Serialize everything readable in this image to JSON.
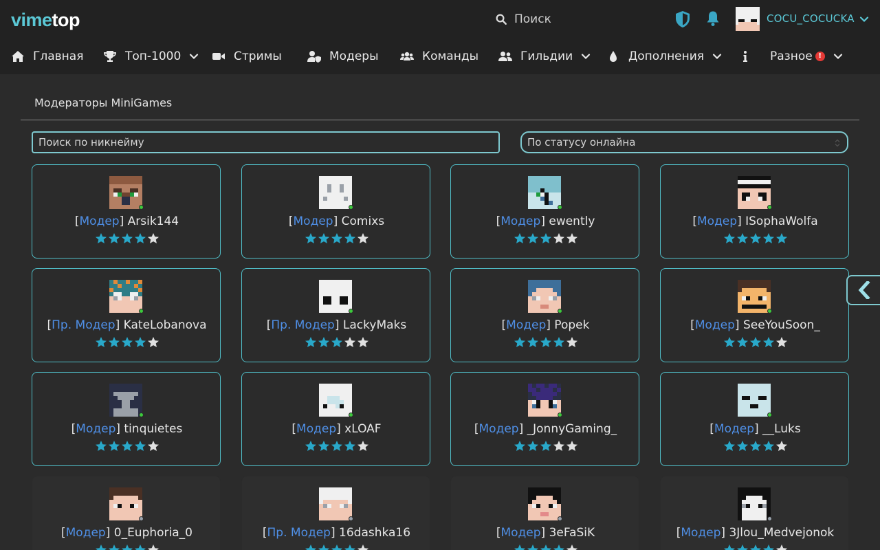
{
  "header": {
    "logo_part1": "vime",
    "logo_part2": "top",
    "search_label": "Поиск",
    "username": "COCU_COCUCKA"
  },
  "nav": [
    {
      "label": "Главная",
      "icon": "home-icon",
      "dropdown": false
    },
    {
      "label": "Топ-1000",
      "icon": "trophy-icon",
      "dropdown": true
    },
    {
      "label": "Стримы",
      "icon": "video-icon",
      "dropdown": false
    },
    {
      "label": "Модеры",
      "icon": "user-shield-icon",
      "dropdown": false
    },
    {
      "label": "Команды",
      "icon": "users-icon",
      "dropdown": false
    },
    {
      "label": "Гильдии",
      "icon": "user-group-icon",
      "dropdown": true
    },
    {
      "label": "Дополнения",
      "icon": "drop-icon",
      "dropdown": true
    },
    {
      "label": "Разное",
      "icon": "info-icon",
      "dropdown": true,
      "badge": "!"
    }
  ],
  "panel": {
    "title": "Модераторы MiniGames",
    "search_placeholder": "Поиск по никнейму",
    "status_select": "По статусу онлайна"
  },
  "moderators": [
    {
      "role": "Модер",
      "name": "Arsik144",
      "rating": 4,
      "online": true,
      "skin": "villager"
    },
    {
      "role": "Модер",
      "name": "Comixs",
      "rating": 4,
      "online": true,
      "skin": "white"
    },
    {
      "role": "Модер",
      "name": "ewently",
      "rating": 3,
      "online": true,
      "skin": "cyan"
    },
    {
      "role": "Модер",
      "name": "ISophaWolfa",
      "rating": 5,
      "online": true,
      "skin": "maid"
    },
    {
      "role": "Пр. Модер",
      "name": "KateLobanova",
      "rating": 4,
      "online": true,
      "skin": "teal-orange"
    },
    {
      "role": "Пр. Модер",
      "name": "LackyMaks",
      "rating": 3,
      "online": true,
      "skin": "white-dark"
    },
    {
      "role": "Модер",
      "name": "Popek",
      "rating": 4,
      "online": true,
      "skin": "brown-hair"
    },
    {
      "role": "Модер",
      "name": "SeeYouSoon_",
      "rating": 4,
      "online": true,
      "skin": "steve"
    },
    {
      "role": "Модер",
      "name": "tinquietes",
      "rating": 4,
      "online": true,
      "skin": "navy"
    },
    {
      "role": "Модер",
      "name": "xLOAF",
      "rating": 4,
      "online": true,
      "skin": "white-gray"
    },
    {
      "role": "Модер",
      "name": "_JonnyGaming_",
      "rating": 3,
      "online": true,
      "skin": "purple"
    },
    {
      "role": "Модер",
      "name": "__Luks",
      "rating": 4,
      "online": true,
      "skin": "gray"
    },
    {
      "role": "Модер",
      "name": "0_Euphoria_0",
      "rating": 4,
      "online": false,
      "skin": "dark-hair",
      "faded": true
    },
    {
      "role": "Пр. Модер",
      "name": "16dashka16",
      "rating": 4,
      "online": false,
      "skin": "pink-white",
      "faded": true
    },
    {
      "role": "Модер",
      "name": "3eFaSiK",
      "rating": 4,
      "online": false,
      "skin": "black-pink",
      "faded": true
    },
    {
      "role": "Модер",
      "name": "3Jlou_Medvejonok",
      "rating": 4,
      "online": false,
      "skin": "black-white",
      "faded": true
    }
  ],
  "colors": {
    "accent": "#5bc8d6",
    "card_border": "#50bfc9",
    "role": "#4f8fe6",
    "star_on": "#29a8c9",
    "star_off": "#e0e0e0",
    "online": "#3cc93c",
    "badge": "#e53935"
  }
}
